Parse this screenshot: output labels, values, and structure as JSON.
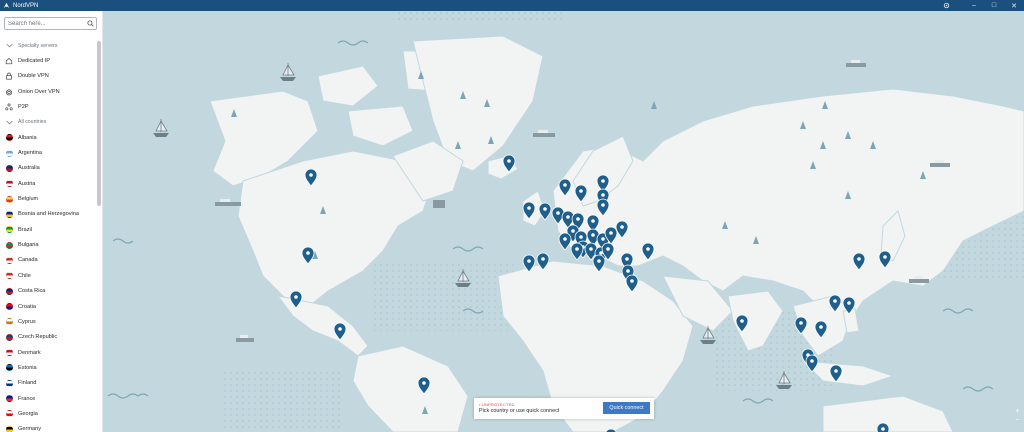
{
  "app": {
    "title": "NordVPN"
  },
  "window_controls": {
    "settings_icon": "gear-icon",
    "minimize": "–",
    "maximize": "□",
    "close": "✕"
  },
  "search": {
    "placeholder": "Search here..."
  },
  "sidebar": {
    "specialty_header": "Specialty servers",
    "specialty": [
      {
        "label": "Dedicated IP",
        "icon": "home-icon"
      },
      {
        "label": "Double VPN",
        "icon": "lock-icon"
      },
      {
        "label": "Onion Over VPN",
        "icon": "onion-icon"
      },
      {
        "label": "P2P",
        "icon": "p2p-icon"
      }
    ],
    "countries_header": "All countries",
    "countries": [
      {
        "label": "Albania",
        "color": "#d9211d",
        "color2": "#000000"
      },
      {
        "label": "Argentina",
        "color": "#74acdf",
        "color2": "#ffffff"
      },
      {
        "label": "Australia",
        "color": "#0b2a6b",
        "color2": "#c8102e"
      },
      {
        "label": "Austria",
        "color": "#c8102e",
        "color2": "#ffffff"
      },
      {
        "label": "Belgium",
        "color": "#fdda24",
        "color2": "#ef3340"
      },
      {
        "label": "Bosnia and Herzegovina",
        "color": "#002395",
        "color2": "#fecb00"
      },
      {
        "label": "Brazil",
        "color": "#009c3b",
        "color2": "#ffdf00"
      },
      {
        "label": "Bulgaria",
        "color": "#00966e",
        "color2": "#d62612"
      },
      {
        "label": "Canada",
        "color": "#d52b1e",
        "color2": "#ffffff"
      },
      {
        "label": "Chile",
        "color": "#d52b1e",
        "color2": "#ffffff"
      },
      {
        "label": "Costa Rica",
        "color": "#002b7f",
        "color2": "#ce1126"
      },
      {
        "label": "Croatia",
        "color": "#ff0000",
        "color2": "#171796"
      },
      {
        "label": "Cyprus",
        "color": "#ffffff",
        "color2": "#d57800"
      },
      {
        "label": "Czech Republic",
        "color": "#11457e",
        "color2": "#d7141a"
      },
      {
        "label": "Denmark",
        "color": "#c8102e",
        "color2": "#ffffff"
      },
      {
        "label": "Estonia",
        "color": "#0072ce",
        "color2": "#000000"
      },
      {
        "label": "Finland",
        "color": "#ffffff",
        "color2": "#003580"
      },
      {
        "label": "France",
        "color": "#002395",
        "color2": "#ed2939"
      },
      {
        "label": "Georgia",
        "color": "#ffffff",
        "color2": "#ff0000"
      },
      {
        "label": "Germany",
        "color": "#000000",
        "color2": "#ffce00"
      }
    ]
  },
  "status_card": {
    "state": "• UNPROTECTED",
    "message": "Pick country or use quick connect",
    "button": "Quick connect"
  },
  "zoom": {
    "plus": "+",
    "minus": "−"
  },
  "colors": {
    "titlebar": "#1b4f7e",
    "ocean": "#c2d8de",
    "land": "#f2f4f4",
    "pin": "#1f5f8b",
    "button": "#3d79c4",
    "unprotected": "#e0403a"
  }
}
